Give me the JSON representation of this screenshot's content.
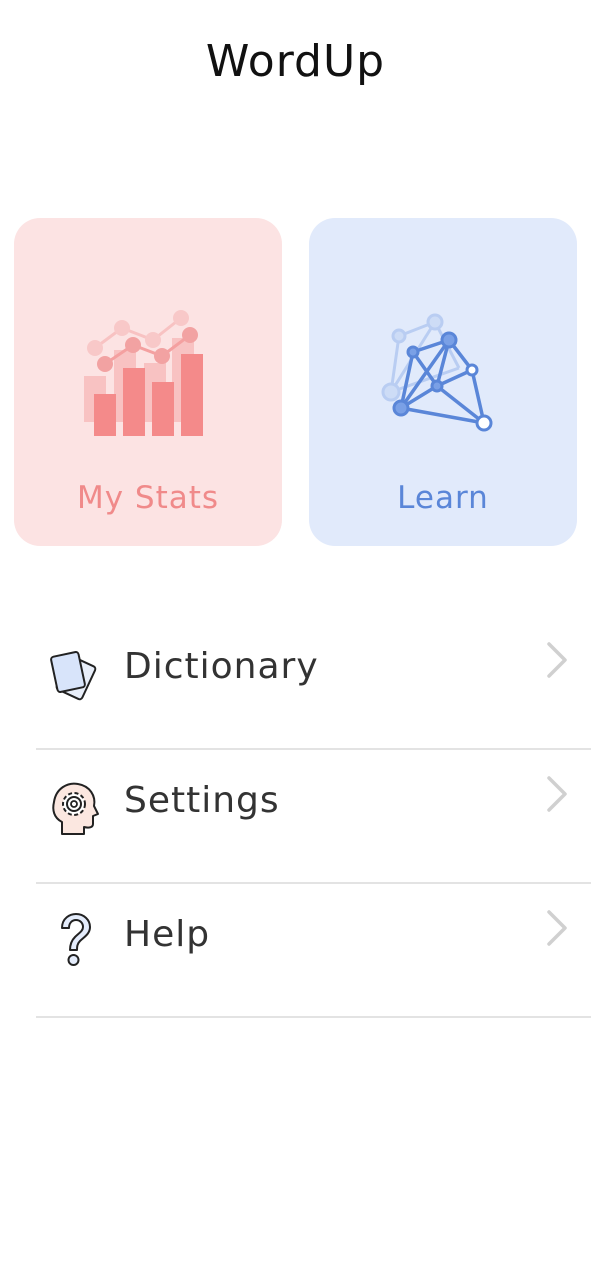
{
  "header": {
    "title": "WordUp"
  },
  "tiles": [
    {
      "label": "My Stats",
      "icon": "bar-chart-icon",
      "color": "#fce3e3",
      "accent": "#f08a8a"
    },
    {
      "label": "Learn",
      "icon": "network-graph-icon",
      "color": "#e1eafb",
      "accent": "#5a86d8"
    }
  ],
  "menu": {
    "items": [
      {
        "label": "Dictionary",
        "icon": "cards-icon"
      },
      {
        "label": "Settings",
        "icon": "head-gear-icon"
      },
      {
        "label": "Help",
        "icon": "question-mark-icon"
      }
    ],
    "chevron_icon": "chevron-right-icon"
  }
}
